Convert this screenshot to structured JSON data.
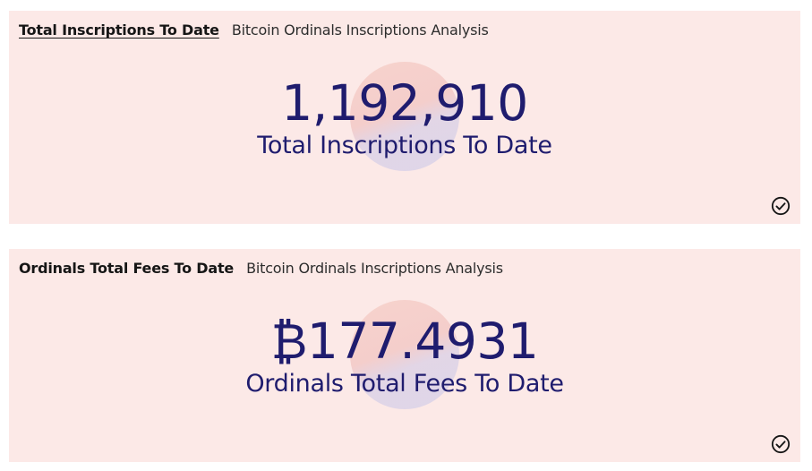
{
  "cards": [
    {
      "title": "Total Inscriptions To Date",
      "subtitle": "Bitcoin Ordinals Inscriptions Analysis",
      "value": "1,192,910",
      "label": "Total Inscriptions To Date",
      "status_icon": "check-circle-icon"
    },
    {
      "title": "Ordinals Total Fees To Date",
      "subtitle": "Bitcoin Ordinals Inscriptions Analysis",
      "value": "₿177.4931",
      "label": "Ordinals Total Fees To Date",
      "status_icon": "check-circle-icon"
    }
  ],
  "colors": {
    "card_background": "#fce9e7",
    "value_text": "#1f1c6e",
    "title_text": "#161616"
  }
}
